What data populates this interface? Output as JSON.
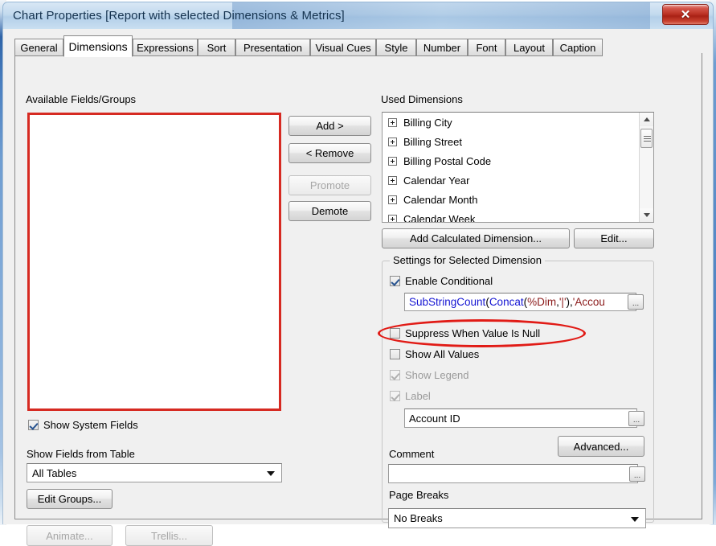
{
  "window": {
    "title": "Chart Properties [Report with selected Dimensions & Metrics]",
    "close_label": "✕"
  },
  "tabs": [
    {
      "label": "General",
      "active": false
    },
    {
      "label": "Dimensions",
      "active": true
    },
    {
      "label": "Expressions",
      "active": false
    },
    {
      "label": "Sort",
      "active": false
    },
    {
      "label": "Presentation",
      "active": false
    },
    {
      "label": "Visual Cues",
      "active": false
    },
    {
      "label": "Style",
      "active": false
    },
    {
      "label": "Number",
      "active": false
    },
    {
      "label": "Font",
      "active": false
    },
    {
      "label": "Layout",
      "active": false
    },
    {
      "label": "Caption",
      "active": false
    }
  ],
  "left_panel": {
    "available_label": "Available Fields/Groups",
    "available_items": [],
    "show_system_fields": {
      "label": "Show System Fields",
      "checked": true,
      "enabled": true
    },
    "show_fields_from_table_label": "Show Fields from Table",
    "table_filter_value": "All Tables",
    "edit_groups_label": "Edit Groups...",
    "animate_label": "Animate...",
    "trellis_label": "Trellis..."
  },
  "transfer_buttons": {
    "add_label": "Add >",
    "remove_label": "< Remove",
    "promote_label": "Promote",
    "demote_label": "Demote"
  },
  "right_panel": {
    "used_dimensions_label": "Used Dimensions",
    "used_dimensions": [
      "Billing City",
      "Billing Street",
      "Billing Postal Code",
      "Calendar Year",
      "Calendar Month",
      "Calendar Week"
    ],
    "add_calculated_dimension_label": "Add Calculated Dimension...",
    "edit_label": "Edit...",
    "settings_group_title": "Settings for Selected Dimension",
    "enable_conditional": {
      "label": "Enable Conditional",
      "checked": true,
      "enabled": true
    },
    "conditional_expression": {
      "tokens": [
        {
          "text": "SubStringCount",
          "type": "fn"
        },
        {
          "text": "(",
          "type": "pun"
        },
        {
          "text": "Concat",
          "type": "fn"
        },
        {
          "text": "(",
          "type": "pun"
        },
        {
          "text": "%Dim",
          "type": "var"
        },
        {
          "text": ", ",
          "type": "pun"
        },
        {
          "text": "'|'",
          "type": "str"
        },
        {
          "text": "), ",
          "type": "pun"
        },
        {
          "text": "'Accou",
          "type": "str"
        }
      ],
      "plain": "SubStringCount(Concat(%Dim, '|'), 'Accou"
    },
    "suppress_when_null": {
      "label": "Suppress When Value Is Null",
      "checked": false,
      "enabled": true
    },
    "show_all_values": {
      "label": "Show All Values",
      "checked": false,
      "enabled": true
    },
    "show_legend": {
      "label": "Show Legend",
      "checked": true,
      "enabled": false
    },
    "label_checkbox": {
      "label": "Label",
      "checked": true,
      "enabled": false
    },
    "label_value": "Account ID",
    "advanced_label": "Advanced...",
    "comment_label": "Comment",
    "comment_value": "",
    "page_breaks_label": "Page Breaks",
    "page_breaks_value": "No Breaks",
    "browse_button_label": "..."
  },
  "annotations": {
    "available_list_highlight_color": "#d62a22",
    "suppress_null_ellipse_color": "#e11b16"
  }
}
